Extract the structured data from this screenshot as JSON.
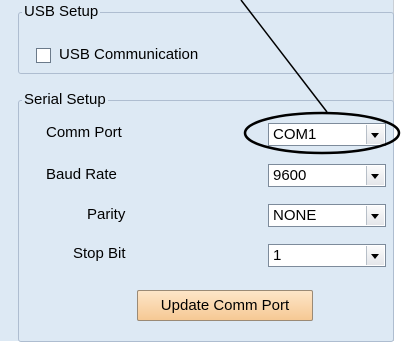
{
  "usb_setup": {
    "title": "USB Setup",
    "usb_communication_label": "USB Communication",
    "usb_communication_checked": false
  },
  "serial_setup": {
    "title": "Serial Setup",
    "comm_port": {
      "label": "Comm Port",
      "value": "COM1"
    },
    "baud_rate": {
      "label": "Baud Rate",
      "value": "9600"
    },
    "parity": {
      "label": "Parity",
      "value": "NONE"
    },
    "stop_bit": {
      "label": "Stop Bit",
      "value": "1"
    }
  },
  "update_button_label": "Update Comm Port"
}
